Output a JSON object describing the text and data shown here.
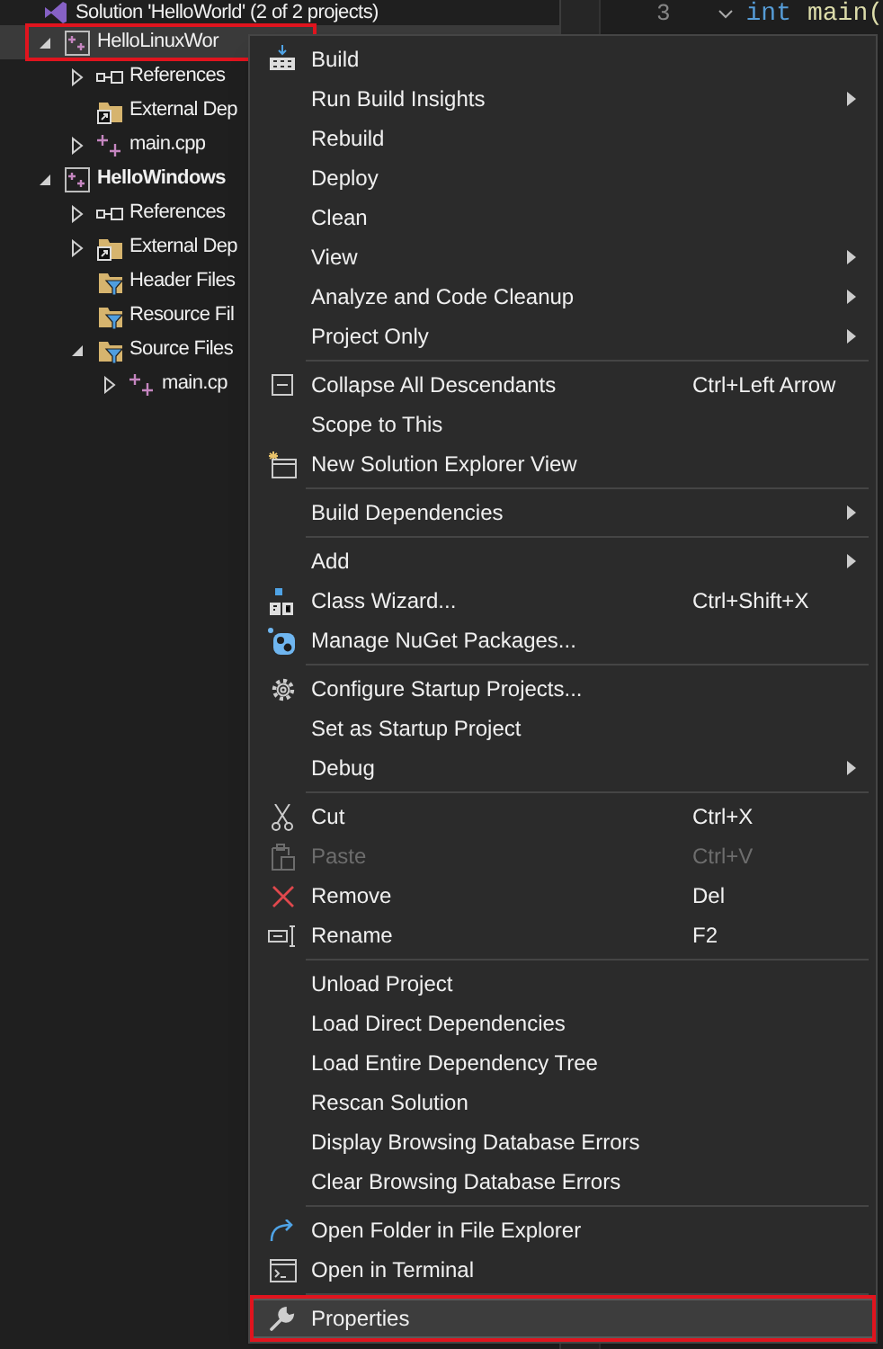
{
  "solution_explorer": {
    "tree": [
      {
        "label": "Solution 'HelloWorld' (2 of 2 projects)",
        "kind": "solution",
        "selected": false,
        "bold": false,
        "children": [
          {
            "label": "HelloLinuxWor",
            "kind": "project",
            "selected": true,
            "bold": false,
            "expanded": true,
            "children": [
              {
                "label": "References",
                "kind": "references",
                "selected": false,
                "bold": false,
                "expanded": false
              },
              {
                "label": "External Dep",
                "kind": "external",
                "selected": false,
                "bold": false
              },
              {
                "label": "main.cpp",
                "kind": "file",
                "selected": false,
                "bold": false,
                "expanded": false
              }
            ]
          },
          {
            "label": "HelloWindows",
            "kind": "project",
            "selected": false,
            "bold": true,
            "expanded": true,
            "children": [
              {
                "label": "References",
                "kind": "references",
                "selected": false,
                "bold": false,
                "expanded": false
              },
              {
                "label": "External Dep",
                "kind": "external",
                "selected": false,
                "bold": false,
                "expanded": false
              },
              {
                "label": "Header Files",
                "kind": "filter",
                "selected": false,
                "bold": false
              },
              {
                "label": "Resource Fil",
                "kind": "filter",
                "selected": false,
                "bold": false
              },
              {
                "label": "Source Files",
                "kind": "filter",
                "selected": false,
                "bold": false,
                "expanded": true,
                "children": [
                  {
                    "label": "main.cp",
                    "kind": "file",
                    "selected": false,
                    "bold": false,
                    "expanded": false
                  }
                ]
              }
            ]
          }
        ]
      }
    ]
  },
  "editor": {
    "line_number": "3",
    "code": [
      {
        "text": "int",
        "kind": "keyword"
      },
      {
        "text": "main(",
        "kind": "function"
      }
    ]
  },
  "context_menu": {
    "items": [
      {
        "kind": "item",
        "label": "Build",
        "submenu": false,
        "disabled": false,
        "selected": false
      },
      {
        "kind": "item",
        "label": "Run Build Insights",
        "submenu": true,
        "disabled": false,
        "selected": false
      },
      {
        "kind": "item",
        "label": "Rebuild",
        "submenu": false,
        "disabled": false,
        "selected": false
      },
      {
        "kind": "item",
        "label": "Deploy",
        "submenu": false,
        "disabled": false,
        "selected": false
      },
      {
        "kind": "item",
        "label": "Clean",
        "submenu": false,
        "disabled": false,
        "selected": false
      },
      {
        "kind": "item",
        "label": "View",
        "submenu": true,
        "disabled": false,
        "selected": false
      },
      {
        "kind": "item",
        "label": "Analyze and Code Cleanup",
        "submenu": true,
        "disabled": false,
        "selected": false
      },
      {
        "kind": "item",
        "label": "Project Only",
        "submenu": true,
        "disabled": false,
        "selected": false
      },
      {
        "kind": "separator"
      },
      {
        "kind": "item",
        "label": "Collapse All Descendants",
        "shortcut": "Ctrl+Left Arrow",
        "submenu": false,
        "disabled": false,
        "selected": false
      },
      {
        "kind": "item",
        "label": "Scope to This",
        "submenu": false,
        "disabled": false,
        "selected": false
      },
      {
        "kind": "item",
        "label": "New Solution Explorer View",
        "submenu": false,
        "disabled": false,
        "selected": false
      },
      {
        "kind": "separator"
      },
      {
        "kind": "item",
        "label": "Build Dependencies",
        "submenu": true,
        "disabled": false,
        "selected": false
      },
      {
        "kind": "separator"
      },
      {
        "kind": "item",
        "label": "Add",
        "submenu": true,
        "disabled": false,
        "selected": false
      },
      {
        "kind": "item",
        "label": "Class Wizard...",
        "shortcut": "Ctrl+Shift+X",
        "submenu": false,
        "disabled": false,
        "selected": false
      },
      {
        "kind": "item",
        "label": "Manage NuGet Packages...",
        "submenu": false,
        "disabled": false,
        "selected": false
      },
      {
        "kind": "separator"
      },
      {
        "kind": "item",
        "label": "Configure Startup Projects...",
        "submenu": false,
        "disabled": false,
        "selected": false
      },
      {
        "kind": "item",
        "label": "Set as Startup Project",
        "submenu": false,
        "disabled": false,
        "selected": false
      },
      {
        "kind": "item",
        "label": "Debug",
        "submenu": true,
        "disabled": false,
        "selected": false
      },
      {
        "kind": "separator"
      },
      {
        "kind": "item",
        "label": "Cut",
        "shortcut": "Ctrl+X",
        "submenu": false,
        "disabled": false,
        "selected": false
      },
      {
        "kind": "item",
        "label": "Paste",
        "shortcut": "Ctrl+V",
        "submenu": false,
        "disabled": true,
        "selected": false
      },
      {
        "kind": "item",
        "label": "Remove",
        "shortcut": "Del",
        "submenu": false,
        "disabled": false,
        "selected": false
      },
      {
        "kind": "item",
        "label": "Rename",
        "shortcut": "F2",
        "submenu": false,
        "disabled": false,
        "selected": false
      },
      {
        "kind": "separator"
      },
      {
        "kind": "item",
        "label": "Unload Project",
        "submenu": false,
        "disabled": false,
        "selected": false
      },
      {
        "kind": "item",
        "label": "Load Direct Dependencies",
        "submenu": false,
        "disabled": false,
        "selected": false
      },
      {
        "kind": "item",
        "label": "Load Entire Dependency Tree",
        "submenu": false,
        "disabled": false,
        "selected": false
      },
      {
        "kind": "item",
        "label": "Rescan Solution",
        "submenu": false,
        "disabled": false,
        "selected": false
      },
      {
        "kind": "item",
        "label": "Display Browsing Database Errors",
        "submenu": false,
        "disabled": false,
        "selected": false
      },
      {
        "kind": "item",
        "label": "Clear Browsing Database Errors",
        "submenu": false,
        "disabled": false,
        "selected": false
      },
      {
        "kind": "separator"
      },
      {
        "kind": "item",
        "label": "Open Folder in File Explorer",
        "submenu": false,
        "disabled": false,
        "selected": false
      },
      {
        "kind": "item",
        "label": "Open in Terminal",
        "submenu": false,
        "disabled": false,
        "selected": false
      },
      {
        "kind": "separator"
      },
      {
        "kind": "item",
        "label": "Properties",
        "submenu": false,
        "disabled": false,
        "selected": true
      }
    ]
  }
}
